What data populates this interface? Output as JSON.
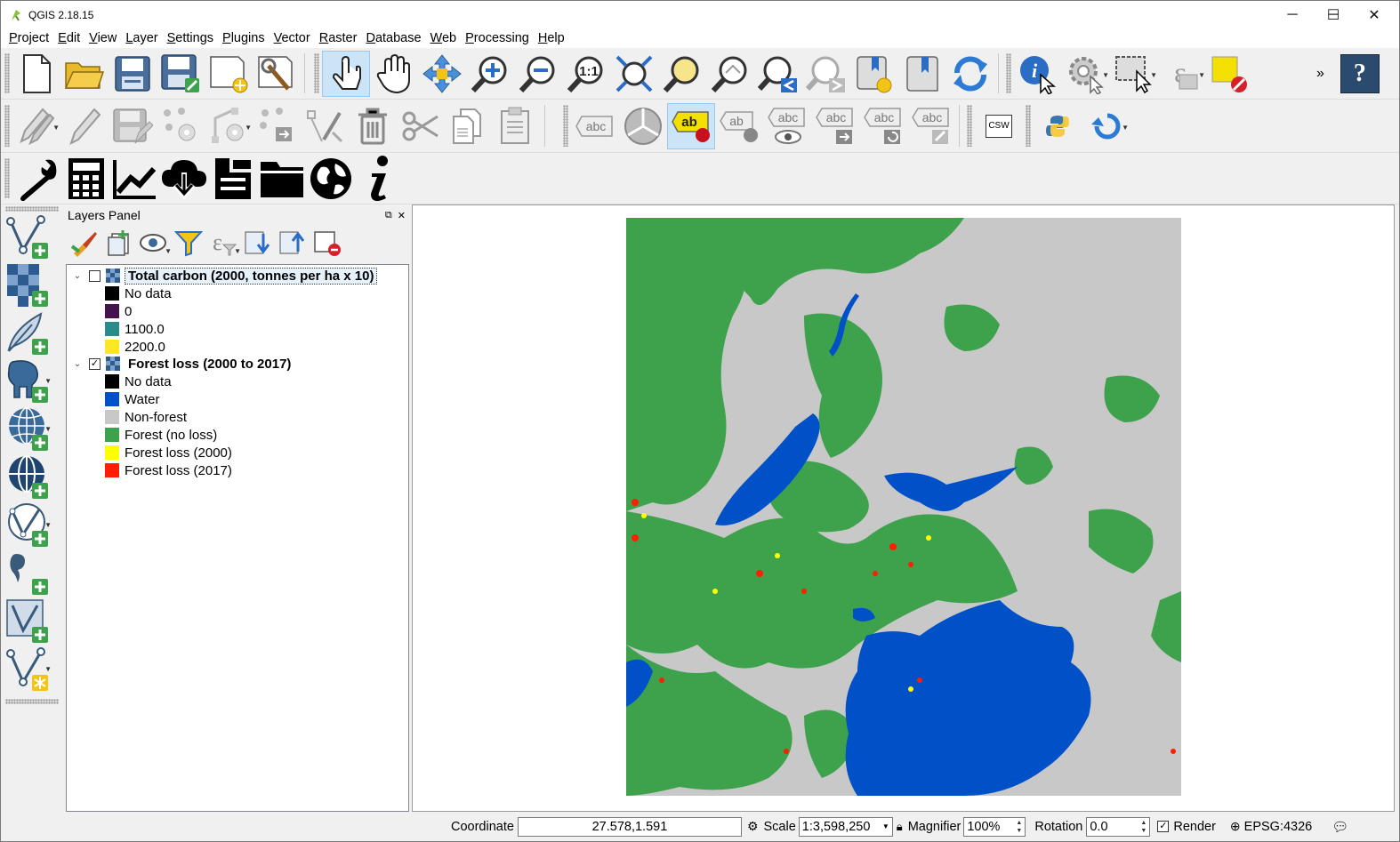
{
  "window": {
    "title": "QGIS 2.18.15",
    "controls": {
      "minimize": "─",
      "maximize": "☐",
      "close": "✕"
    }
  },
  "menu": [
    "Project",
    "Edit",
    "View",
    "Layer",
    "Settings",
    "Plugins",
    "Vector",
    "Raster",
    "Database",
    "Web",
    "Processing",
    "Help"
  ],
  "toolbar1": {
    "buttons": [
      "new-project",
      "open-project",
      "save-project",
      "save-as",
      "new-print-composer",
      "composer-manager",
      "touch-zoom",
      "pan-map",
      "pan-to-selection",
      "zoom-in",
      "zoom-out",
      "zoom-native",
      "zoom-full",
      "zoom-to-selection",
      "zoom-to-layer",
      "zoom-last",
      "zoom-next",
      "new-bookmark",
      "show-bookmarks",
      "refresh",
      "identify-features",
      "run-feature-action",
      "select-features",
      "select-by-expression",
      "deselect-all"
    ],
    "overflow": "»",
    "help": "?"
  },
  "toolbar2": {
    "buttons": [
      "current-edits",
      "toggle-editing",
      "save-layer-edits",
      "add-feature",
      "move-feature",
      "node-tool",
      "delete-selected",
      "cut-features",
      "copy-features",
      "paste-features",
      "layer-labeling",
      "label-diagram",
      "pin-labels",
      "highlight-pinned",
      "show-hide-labels",
      "move-label",
      "rotate-label",
      "change-label",
      "metasearch",
      "python-console",
      "processing-history"
    ],
    "label_abc": "abc",
    "label_ab": "ab",
    "csw": "CSW"
  },
  "toolbar3": {
    "buttons": [
      "wrench",
      "calculator",
      "chart",
      "cloud-download",
      "layout",
      "folder",
      "globe",
      "info"
    ]
  },
  "lefttools": [
    "add-vector-layer",
    "add-raster-layer",
    "add-delimited-text",
    "add-postgis",
    "add-wms",
    "add-wcs",
    "add-wfs",
    "add-spatialite",
    "add-virtual-layer",
    "new-shapefile"
  ],
  "panel": {
    "title": "Layers Panel",
    "tools": [
      "open-styling",
      "add-group",
      "manage-visibility",
      "filter-legend",
      "filter-by-expression",
      "expand-all",
      "collapse-all",
      "remove-layer"
    ],
    "layers": [
      {
        "name": "Total carbon (2000, tonnes per ha x 10)",
        "checked": "",
        "expanded": "⌄",
        "legend": [
          {
            "label": "No data",
            "color": "#000000"
          },
          {
            "label": "0",
            "color": "#43124f"
          },
          {
            "label": "1100.0",
            "color": "#2a8c8a"
          },
          {
            "label": "2200.0",
            "color": "#fde725"
          }
        ]
      },
      {
        "name": "Forest loss (2000 to 2017)",
        "checked": "✓",
        "expanded": "⌄",
        "legend": [
          {
            "label": "No data",
            "color": "#000000"
          },
          {
            "label": "Water",
            "color": "#0050c8"
          },
          {
            "label": "Non-forest",
            "color": "#c8c8c8"
          },
          {
            "label": "Forest (no loss)",
            "color": "#3ea24c"
          },
          {
            "label": "Forest loss (2000)",
            "color": "#ffff00"
          },
          {
            "label": "Forest loss (2017)",
            "color": "#ff1e00"
          }
        ]
      }
    ]
  },
  "map": {
    "colors": {
      "water": "#0050c8",
      "nonforest": "#c8c8c8",
      "forest": "#3ea24c",
      "loss2000": "#ffff00",
      "loss2017": "#ff1e00"
    }
  },
  "status": {
    "coordinate_label": "Coordinate",
    "coordinate_value": "27.578,1.591",
    "scale_label": "Scale",
    "scale_value": "1:3,598,250",
    "magnifier_label": "Magnifier",
    "magnifier_value": "100%",
    "rotation_label": "Rotation",
    "rotation_value": "0.0",
    "render_label": "Render",
    "render_checked": "✓",
    "crs": "EPSG:4326"
  }
}
